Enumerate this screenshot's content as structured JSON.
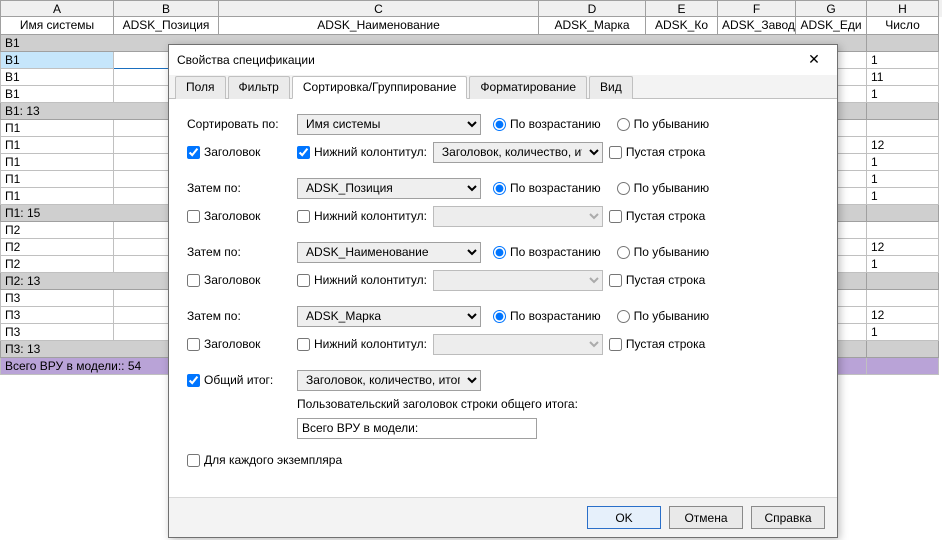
{
  "sheet": {
    "col_letters": [
      "A",
      "B",
      "C",
      "D",
      "E",
      "F",
      "G",
      "H"
    ],
    "field_headers": [
      "Имя системы",
      "ADSK_Позиция",
      "ADSK_Наименование",
      "ADSK_Марка",
      "ADSK_Ко",
      "ADSK_Завод",
      "ADSK_Еди",
      "Число"
    ],
    "rows": [
      {
        "kind": "grouphead",
        "a": "В1",
        "h": ""
      },
      {
        "kind": "data",
        "sel": true,
        "a": "В1",
        "h": "1"
      },
      {
        "kind": "data",
        "a": "В1",
        "h": "11"
      },
      {
        "kind": "data",
        "a": "В1",
        "h": "1"
      },
      {
        "kind": "grouphead",
        "a": "В1: 13",
        "h": ""
      },
      {
        "kind": "data",
        "a": "П1",
        "h": ""
      },
      {
        "kind": "data",
        "a": "П1",
        "h": "12"
      },
      {
        "kind": "data",
        "a": "П1",
        "h": "1"
      },
      {
        "kind": "data",
        "a": "П1",
        "h": "1"
      },
      {
        "kind": "data",
        "a": "П1",
        "h": "1"
      },
      {
        "kind": "grouphead",
        "a": "П1: 15",
        "h": ""
      },
      {
        "kind": "data",
        "a": "П2",
        "h": ""
      },
      {
        "kind": "data",
        "a": "П2",
        "h": "12"
      },
      {
        "kind": "data",
        "a": "П2",
        "h": "1"
      },
      {
        "kind": "grouphead",
        "a": "П2: 13",
        "h": ""
      },
      {
        "kind": "data",
        "a": "П3",
        "h": ""
      },
      {
        "kind": "data",
        "a": "П3",
        "h": "12"
      },
      {
        "kind": "data",
        "a": "П3",
        "h": "1"
      },
      {
        "kind": "grouphead",
        "a": "П3: 13",
        "h": ""
      },
      {
        "kind": "total",
        "a": "Всего ВРУ в модели:: 54",
        "h": ""
      }
    ]
  },
  "dialog": {
    "title": "Свойства спецификации",
    "tabs": [
      "Поля",
      "Фильтр",
      "Сортировка/Группирование",
      "Форматирование",
      "Вид"
    ],
    "active_tab": 2,
    "labels": {
      "sort_by": "Сортировать по:",
      "then_by": "Затем по:",
      "header": "Заголовок",
      "footer": "Нижний колонтитул:",
      "asc": "По возрастанию",
      "desc": "По убыванию",
      "blank": "Пустая строка",
      "grand_total": "Общий итог:",
      "custom_caption": "Пользовательский заголовок строки общего итога:",
      "per_instance": "Для каждого экземпляра"
    },
    "levels": [
      {
        "field": "Имя системы",
        "header": true,
        "footer": true,
        "footer_mode": "Заголовок, количество, ит",
        "asc": true,
        "blank": false
      },
      {
        "field": "ADSK_Позиция",
        "header": false,
        "footer": false,
        "footer_mode": "",
        "asc": true,
        "blank": false
      },
      {
        "field": "ADSK_Наименование",
        "header": false,
        "footer": false,
        "footer_mode": "",
        "asc": true,
        "blank": false
      },
      {
        "field": "ADSK_Марка",
        "header": false,
        "footer": false,
        "footer_mode": "",
        "asc": true,
        "blank": false
      }
    ],
    "grand_total_checked": true,
    "grand_total_mode": "Заголовок, количество, итого",
    "grand_total_custom_text": "Всего ВРУ в модели:",
    "per_instance_checked": false,
    "buttons": {
      "ok": "OK",
      "cancel": "Отмена",
      "help": "Справка"
    }
  }
}
